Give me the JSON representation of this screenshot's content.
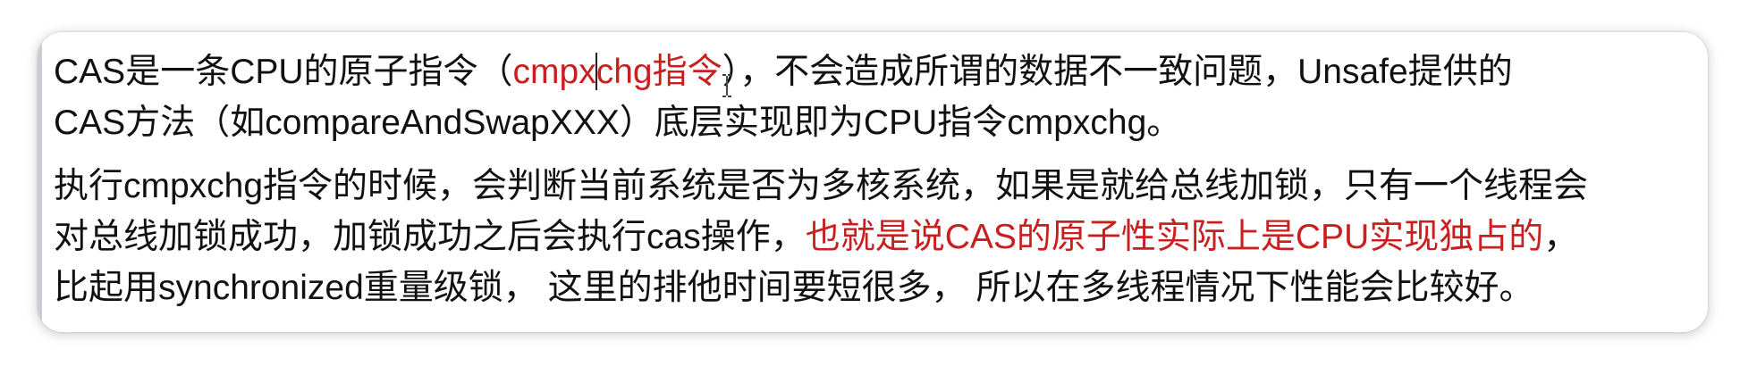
{
  "paragraph1": {
    "line1": {
      "a": "CAS是一条CPU的原子指令（",
      "b_red": "cmpx",
      "c_red": "chg指令",
      "d": "），不会造成所谓的数据不一致问题，Unsafe提供的"
    },
    "line2": "CAS方法（如compareAndSwapXXX）底层实现即为CPU指令cmpxchg。"
  },
  "paragraph2": {
    "line1": "执行cmpxchg指令的时候，会判断当前系统是否为多核系统，如果是就给总线加锁，只有一个线程会",
    "line2": {
      "a": "对总线加锁成功，加锁成功之后会执行cas操作，",
      "b_red": "也就是说CAS的原子性实际上是CPU实现独占的",
      "c": "，"
    },
    "line3": "比起用synchronized重量级锁， 这里的排他时间要短很多， 所以在多线程情况下性能会比较好。"
  },
  "colors": {
    "highlight": "#c8201f",
    "text": "#111111",
    "left_rule": "#c9ccd3"
  },
  "icons": {
    "text_caret": "text-caret-icon",
    "mouse_cursor": "i-beam-cursor-icon"
  }
}
